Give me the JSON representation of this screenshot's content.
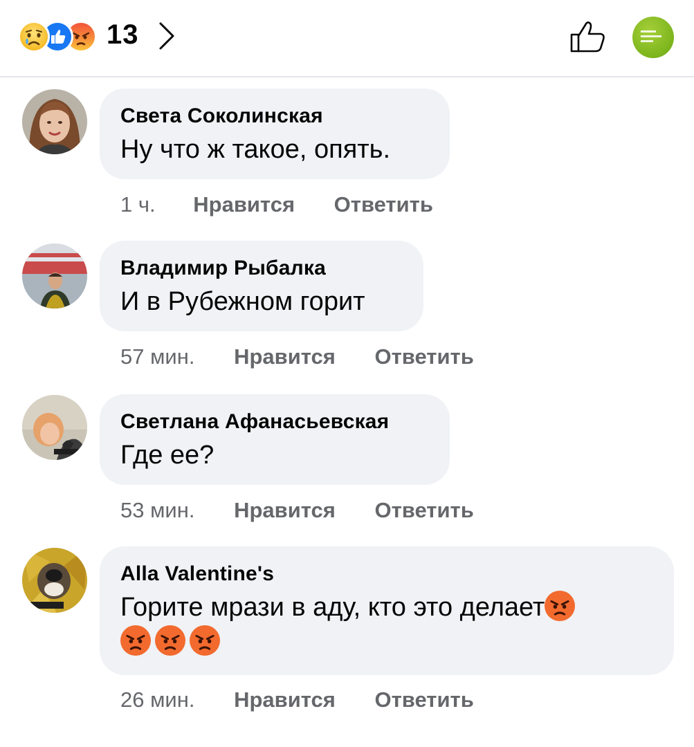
{
  "header": {
    "reaction_count": "13",
    "reactions": [
      "sad-icon",
      "like-icon",
      "angry-icon"
    ],
    "chevron_icon": "chevron-right-icon",
    "like_icon": "thumbs-up-outline-icon",
    "logo_icon": "site-logo"
  },
  "comments": [
    {
      "author": "Света Соколинская",
      "text": "Ну что ж такое, опять.",
      "time": "1 ч.",
      "like_label": "Нравится",
      "reply_label": "Ответить"
    },
    {
      "author": "Владимир Рыбалка",
      "text": "И в Рубежном горит",
      "time": "57 мин.",
      "like_label": "Нравится",
      "reply_label": "Ответить"
    },
    {
      "author": "Светлана Афанасьевская",
      "text": "Где ее?",
      "time": "53 мин.",
      "like_label": "Нравится",
      "reply_label": "Ответить"
    },
    {
      "author": "Alla Valentine's",
      "text": "Горите мрази в аду, кто это делает",
      "emoji": [
        "angry-face",
        "angry-face",
        "angry-face",
        "angry-face"
      ],
      "time": "26 мин.",
      "like_label": "Нравится",
      "reply_label": "Ответить"
    }
  ],
  "colors": {
    "bubble": "#f0f2f5",
    "meta": "#65676b",
    "like_blue": "#1877f2",
    "brand_green": "#7cb51c"
  }
}
